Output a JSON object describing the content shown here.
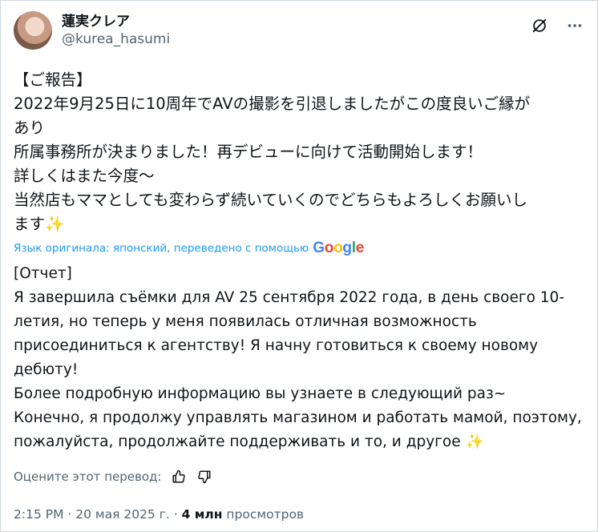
{
  "author": {
    "display_name": "蓮実クレア",
    "handle": "@kurea_hasumi"
  },
  "header_icons": [
    "grok-slash-icon",
    "more-icon"
  ],
  "original_lines": [
    "【ご報告】",
    "2022年9月25日に10周年でAVの撮影を引退しましたがこの度良いご縁が",
    "あり",
    "所属事務所が決まりました！再デビューに向けて活動開始します！",
    "詳しくはまた今度〜",
    "当然店もママとしても変わらず続いていくのでどちらもよろしくお願いし",
    "ます"
  ],
  "sparkle": "✨",
  "translation_note": "Язык оригинала: японский, переведено с помощью",
  "google": [
    "G",
    "o",
    "o",
    "g",
    "l",
    "e"
  ],
  "translation_lines": [
    "[Отчет]",
    "Я завершила съёмки для AV 25 сентября 2022 года, в день своего 10-",
    "летия, но теперь у меня появилась отличная возможность",
    "присоединиться к агентству! Я начну готовиться к своему новому",
    "дебюту!",
    "Более подробную информацию вы узнаете в следующий раз~",
    "Конечно, я продолжу управлять магазином и работать мамой, поэтому,",
    "пожалуйста, продолжайте поддерживать и то, и другое"
  ],
  "rate": {
    "label": "Оцените этот перевод:"
  },
  "meta": {
    "time": "2:15 PM",
    "sep1": " · ",
    "date": "20 мая 2025 г.",
    "sep2": " · ",
    "views_count": "4 млн",
    "views_label": " просмотров"
  },
  "colors": {
    "link": "#1d9bf0",
    "secondary": "#536471",
    "text": "#0f1419",
    "sparkle": "#f3c623"
  }
}
